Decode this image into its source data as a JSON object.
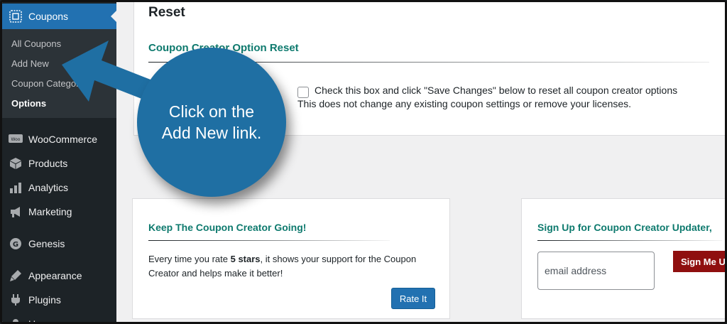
{
  "sidebar": {
    "active_menu": {
      "label": "Coupons",
      "icon": "coupon-icon"
    },
    "submenu": [
      {
        "label": "All Coupons"
      },
      {
        "label": "Add New"
      },
      {
        "label": "Coupon Categories"
      },
      {
        "label": "Options",
        "current": true
      }
    ],
    "items": [
      {
        "label": "WooCommerce",
        "icon": "woo-icon"
      },
      {
        "label": "Products",
        "icon": "products-icon"
      },
      {
        "label": "Analytics",
        "icon": "analytics-icon"
      },
      {
        "label": "Marketing",
        "icon": "marketing-icon"
      },
      {
        "label": "Genesis",
        "icon": "genesis-icon"
      },
      {
        "label": "Appearance",
        "icon": "appearance-icon"
      },
      {
        "label": "Plugins",
        "icon": "plugins-icon"
      },
      {
        "label": "Users",
        "icon": "users-icon"
      }
    ]
  },
  "reset": {
    "title": "Reset",
    "subtitle": "Coupon Creator Option Reset",
    "checkbox_text": "Check this box and click \"Save Changes\" below to reset all coupon creator options",
    "note": "This does not change any existing coupon settings or remove your licenses."
  },
  "keep_card": {
    "title": "Keep The Coupon Creator Going!",
    "text_before": "Every time you rate ",
    "text_bold": "5 stars",
    "text_after": ", it shows your support for the Coupon Creator and helps make it better!",
    "button": "Rate It"
  },
  "signup_card": {
    "title": "Sign Up for Coupon Creator Updater,",
    "email_placeholder": "email address",
    "button": "Sign Me Up"
  },
  "callout": {
    "text": "Click on the Add New link."
  },
  "colors": {
    "sidebar_bg": "#1d2327",
    "submenu_bg": "#2c3338",
    "wp_blue": "#2271b1",
    "heading_teal": "#0e7a6e",
    "signup_red": "#8f0f0f",
    "callout_blue": "#1f6fa3"
  }
}
